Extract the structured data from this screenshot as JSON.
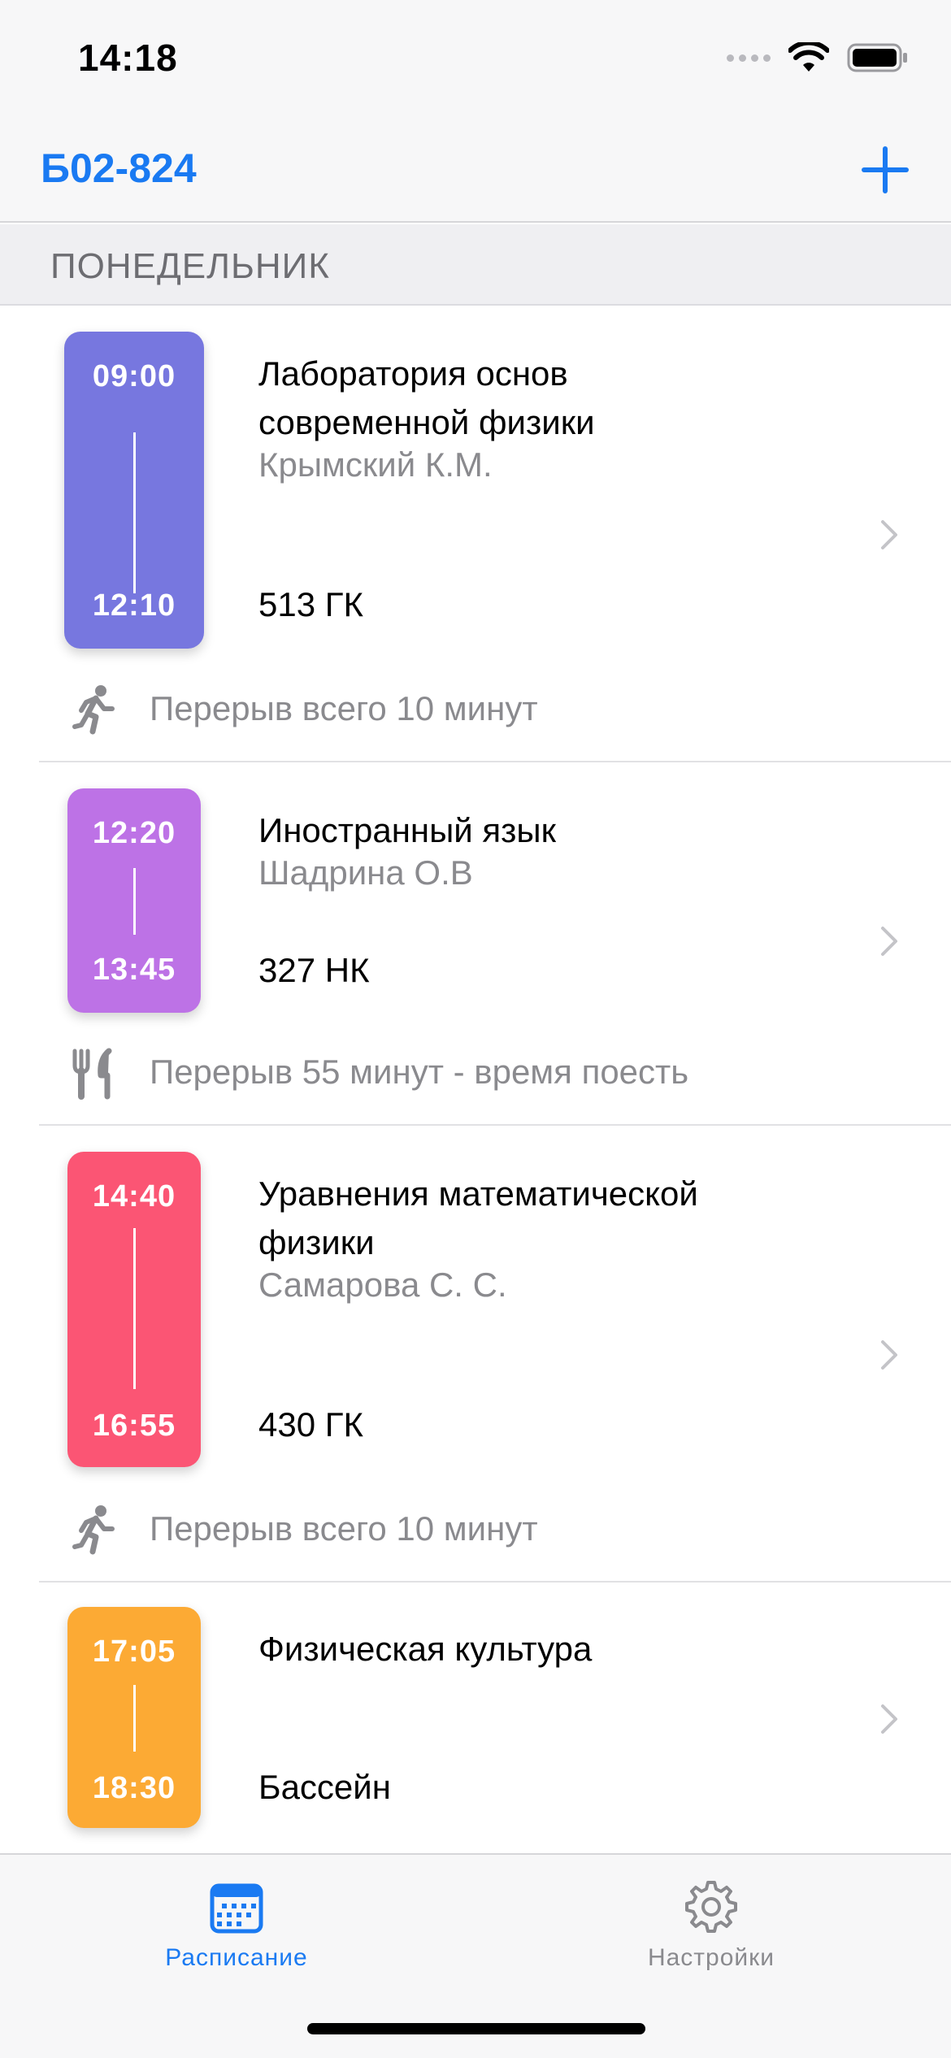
{
  "status_bar": {
    "time": "14:18"
  },
  "nav": {
    "title": "Б02-824",
    "add_icon": "plus-icon"
  },
  "section": {
    "title": "ПОНЕДЕЛЬНИК"
  },
  "lessons": [
    {
      "start": "09:00",
      "end": "12:10",
      "title_line1": "Лаборатория основ",
      "title_line2": "современной физики",
      "teacher": "Крымский К.М.",
      "room": "513 ГК",
      "color": "#7777df"
    },
    {
      "start": "12:20",
      "end": "13:45",
      "title_line1": "Иностранный язык",
      "title_line2": "",
      "teacher": "Шадрина О.В",
      "room": "327 НК",
      "color": "#bd72e6"
    },
    {
      "start": "14:40",
      "end": "16:55",
      "title_line1": "Уравнения математической",
      "title_line2": "физики",
      "teacher": "Самарова С. С.",
      "room": "430 ГК",
      "color": "#fb5574"
    },
    {
      "start": "17:05",
      "end": "18:30",
      "title_line1": "Физическая культура",
      "title_line2": "",
      "teacher": "",
      "room": "Бассейн",
      "color": "#fcaa34"
    }
  ],
  "breaks": [
    {
      "text": "Перерыв всего 10 минут",
      "icon": "running-person-icon"
    },
    {
      "text": "Перерыв 55 минут - время поесть",
      "icon": "fork-knife-icon"
    },
    {
      "text": "Перерыв всего 10 минут",
      "icon": "running-person-icon"
    }
  ],
  "tabs": [
    {
      "label": "Расписание",
      "icon": "calendar-icon",
      "active": true
    },
    {
      "label": "Настройки",
      "icon": "gear-icon",
      "active": false
    }
  ],
  "colors": {
    "accent": "#1a7af2",
    "secondary_text": "#8a8a8e",
    "inactive_tab": "#8a8a8e"
  }
}
